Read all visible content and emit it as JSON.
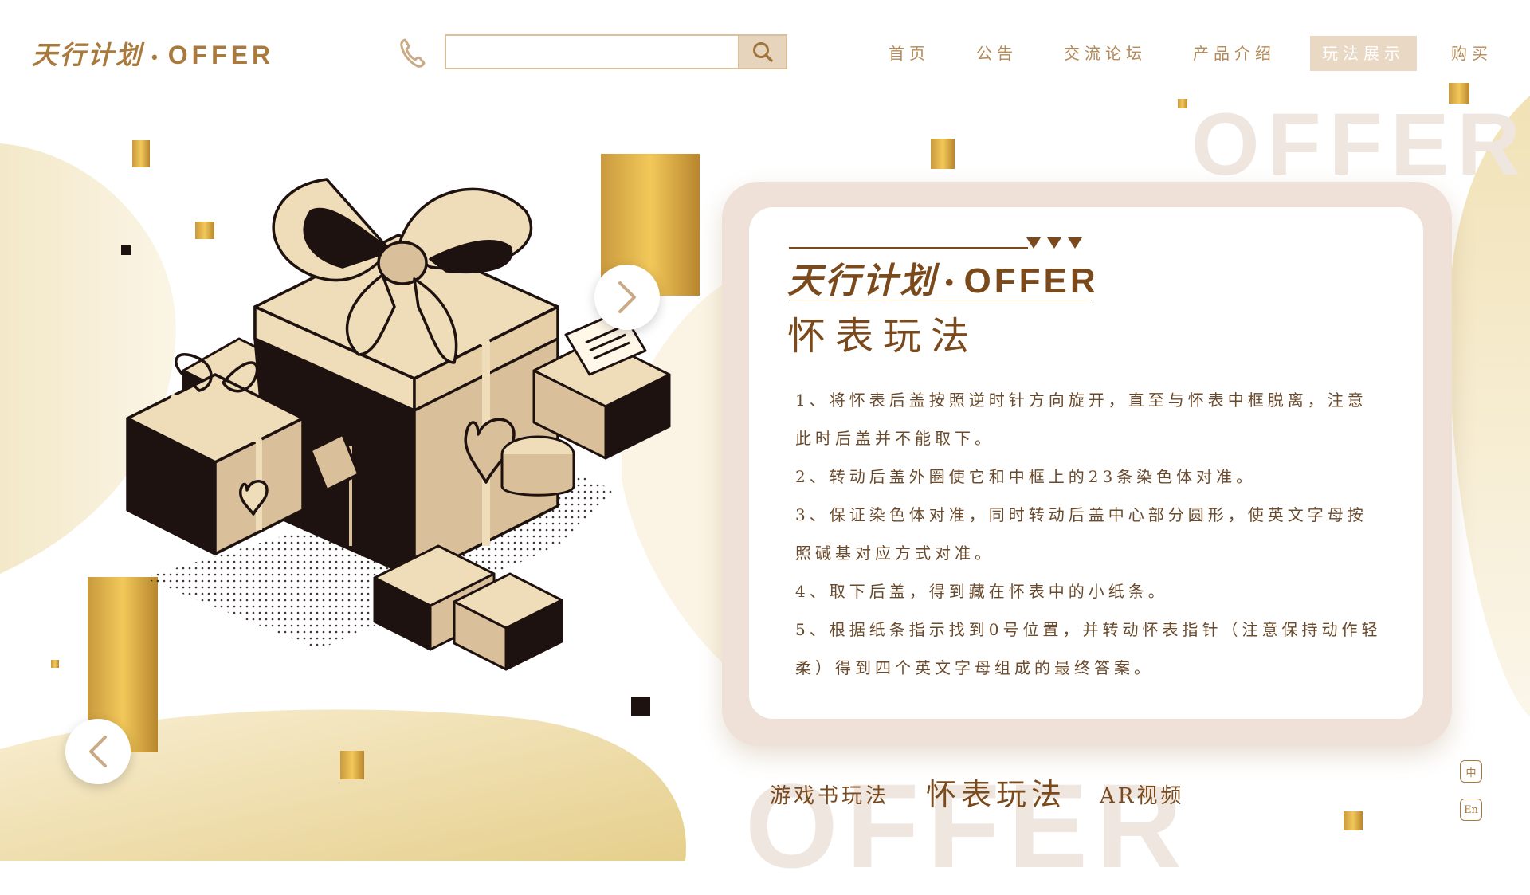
{
  "header": {
    "logo_cn": "天行计划",
    "logo_dot": "•",
    "logo_en": "OFFER",
    "search_placeholder": "",
    "phone_icon": "phone-icon",
    "search_icon": "search-icon"
  },
  "nav": {
    "items": [
      {
        "label": "首页",
        "active": false
      },
      {
        "label": "公告",
        "active": false
      },
      {
        "label": "交流论坛",
        "active": false
      },
      {
        "label": "产品介绍",
        "active": false
      },
      {
        "label": "玩法展示",
        "active": true
      },
      {
        "label": "购买",
        "active": false
      }
    ]
  },
  "background": {
    "offer_top": "OFFER",
    "offer_bottom": "OFFER"
  },
  "card": {
    "logo_cn": "天行计划",
    "logo_dot": "•",
    "logo_en": "OFFER",
    "title": "怀表玩法",
    "steps": [
      "1、将怀表后盖按照逆时针方向旋开，直至与怀表中框脱离，注意此时后盖并不能取下。",
      "2、转动后盖外圈使它和中框上的23条染色体对准。",
      "3、保证染色体对准，同时转动后盖中心部分圆形，使英文字母按照碱基对应方式对准。",
      "4、取下后盖，得到藏在怀表中的小纸条。",
      "5、根据纸条指示找到0号位置，并转动怀表指针（注意保持动作轻柔）得到四个英文字母组成的最终答案。"
    ]
  },
  "tabs": [
    {
      "label": "游戏书玩法",
      "active": false
    },
    {
      "label": "怀表玩法",
      "active": true
    },
    {
      "label": "AR视频",
      "active": false
    }
  ],
  "language": {
    "zh": "中",
    "en": "En"
  },
  "colors": {
    "brand_brown": "#7a4a1c",
    "accent_tan": "#b48a58",
    "gold": "#e6b64e",
    "card_bg": "#efe1d7"
  }
}
